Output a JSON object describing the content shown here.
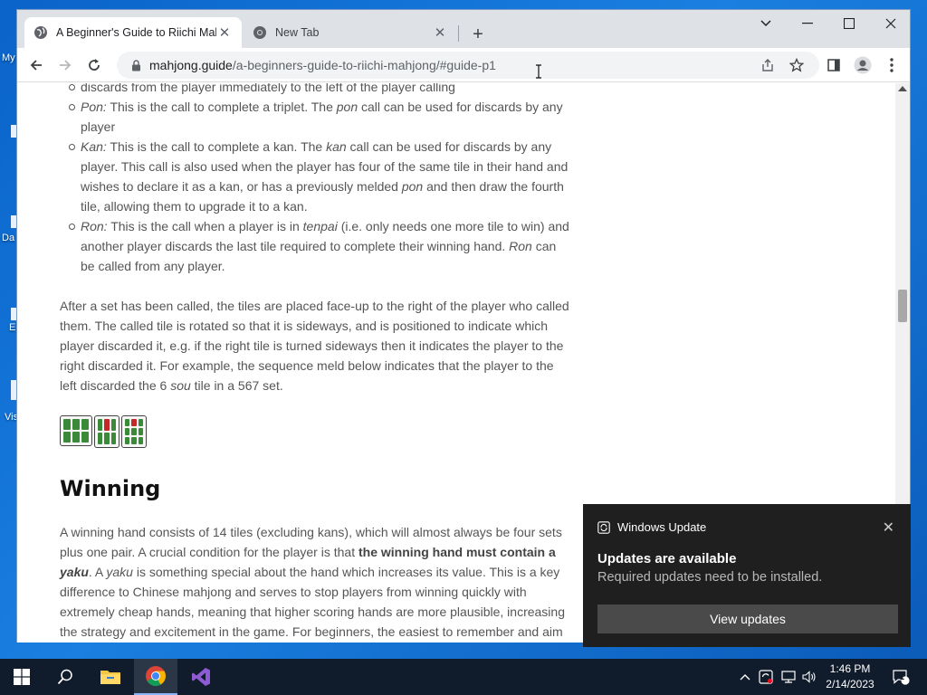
{
  "desktop": {
    "labels": [
      "My",
      "Da",
      "E",
      "Vis"
    ]
  },
  "browser": {
    "tabs": [
      {
        "title": "A Beginner's Guide to Riichi Mah",
        "active": true
      },
      {
        "title": "New Tab",
        "active": false
      }
    ],
    "url_host": "mahjong.guide",
    "url_path": "/a-beginners-guide-to-riichi-mahjong/#guide-p1"
  },
  "article": {
    "top_cut": "discards from the player immediately to the left of the player calling",
    "items": [
      {
        "term": "Pon:",
        "a": " This is the call to complete a triplet. The ",
        "em": "pon",
        "b": " call can be used for discards by any player"
      },
      {
        "term": "Kan:",
        "a": " This is the call to complete a kan. The ",
        "em": "kan",
        "b": " call can be used for discards by any player. This call is also used when the player has four of the same tile in their hand and wishes to declare it as a kan, or has a previously melded ",
        "em2": "pon",
        "c": " and then draw the fourth tile, allowing them to upgrade it to a kan."
      },
      {
        "term": "Ron:",
        "a": " This is the call when a player is in ",
        "em": "tenpai",
        "b": " (i.e. only needs one more tile to win) and another player discards the last tile required to complete their winning hand. ",
        "em2": "Ron",
        "c": " can be called from any player."
      }
    ],
    "para1_a": "After a set has been called, the tiles are placed face-up to the right of the player who called them. The called tile is rotated so that it is sideways, and is positioned to indicate which player discarded it, e.g. if the right tile is turned sideways then it indicates the player to the right discarded it. For example, the sequence meld below indicates that the player to the left discarded the 6 ",
    "para1_em": "sou",
    "para1_b": " tile in a 567 set.",
    "heading": "Winning",
    "para2_a": "A winning hand consists of 14 tiles (excluding kans), which will almost always be four sets plus one pair. A crucial condition for the player is that ",
    "para2_bold": "the winning hand must contain a ",
    "para2_bold_em": "yaku",
    "para2_b": ". A ",
    "para2_em": "yaku",
    "para2_c": " is something special about the hand which increases its value. This is a key difference to Chinese mahjong and serves to stop players from winning quickly with extremely cheap hands, meaning that higher scoring hands are more plausible, increasing the strategy and excitement in the game. For beginners, the easiest to remember and aim"
  },
  "toast": {
    "app": "Windows Update",
    "title": "Updates are available",
    "body": "Required updates need to be installed.",
    "button": "View updates"
  },
  "taskbar": {
    "time": "1:46 PM",
    "date": "2/14/2023",
    "notifications": "1"
  }
}
